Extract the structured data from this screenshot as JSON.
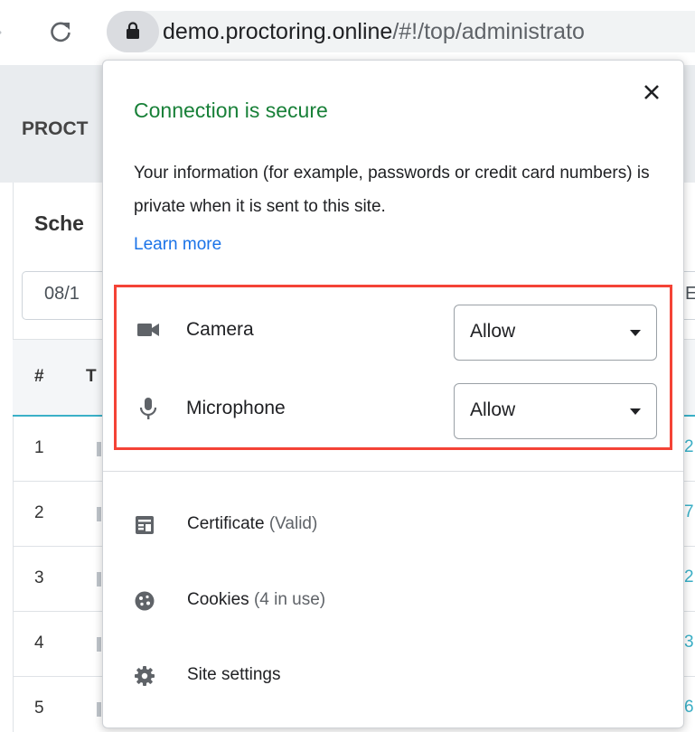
{
  "browser": {
    "url_host": "demo.proctoring.online",
    "url_path": "/#!/top/administrato"
  },
  "background_page": {
    "brand": "PROCT",
    "section_title": "Sche",
    "date_value": "08/1",
    "date_value_right": "E",
    "table": {
      "columns": [
        "#",
        "T"
      ],
      "rows": [
        {
          "num": "1",
          "link": "2"
        },
        {
          "num": "2",
          "link": "7"
        },
        {
          "num": "3",
          "link": "2"
        },
        {
          "num": "4",
          "link": "3"
        },
        {
          "num": "5",
          "link": "6"
        }
      ]
    }
  },
  "popup": {
    "title": "Connection is secure",
    "body": "Your information (for example, passwords or credit card numbers) is private when it is sent to this site.",
    "learn_more": "Learn more",
    "permissions": [
      {
        "label": "Camera",
        "value": "Allow",
        "icon": "camera-icon"
      },
      {
        "label": "Microphone",
        "value": "Allow",
        "icon": "microphone-icon"
      }
    ],
    "menu": [
      {
        "label": "Certificate",
        "sub": "(Valid)",
        "icon": "certificate-icon"
      },
      {
        "label": "Cookies",
        "sub": "(4 in use)",
        "icon": "cookies-icon"
      },
      {
        "label": "Site settings",
        "sub": "",
        "icon": "gear-icon"
      }
    ]
  },
  "colors": {
    "secure_green": "#188038",
    "link_blue": "#1a73e8",
    "highlight_red": "#f44336",
    "table_accent": "#3ab0c7"
  }
}
